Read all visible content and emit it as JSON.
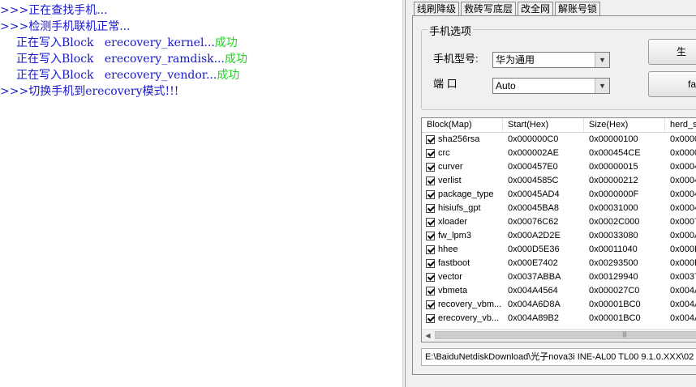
{
  "log": {
    "lines": [
      {
        "text": ">>>正在查找手机..."
      },
      {
        "text": ">>>检测手机联机正常..."
      },
      {
        "text": "正在写入Block   erecovery_kernel...",
        "status": "成功"
      },
      {
        "text": "正在写入Block   erecovery_ramdisk...",
        "status": "成功"
      },
      {
        "text": "正在写入Block   erecovery_vendor...",
        "status": "成功"
      },
      {
        "text": ">>>切换手机到erecovery模式!!!"
      }
    ]
  },
  "tabs": [
    "线刷降级",
    "救砖写底层",
    "改全网",
    "解账号锁"
  ],
  "phone_options": {
    "title": "手机选项",
    "model_label": "手机型号:",
    "model_value": "华为通用",
    "port_label": "端    口",
    "port_value": "Auto",
    "button1_label": "生",
    "button2_label": "fa"
  },
  "table": {
    "columns": [
      "Block(Map)",
      "Start(Hex)",
      "Size(Hex)",
      "herd_s"
    ],
    "rows": [
      {
        "checked": true,
        "block": "sha256rsa",
        "start": "0x000000C0",
        "size": "0x00000100",
        "herd": "0x0000"
      },
      {
        "checked": true,
        "block": "crc",
        "start": "0x000002AE",
        "size": "0x000454CE",
        "herd": "0x0000"
      },
      {
        "checked": true,
        "block": "curver",
        "start": "0x000457E0",
        "size": "0x00000015",
        "herd": "0x0004"
      },
      {
        "checked": true,
        "block": "verlist",
        "start": "0x0004585C",
        "size": "0x00000212",
        "herd": "0x0004"
      },
      {
        "checked": true,
        "block": "package_type",
        "start": "0x00045AD4",
        "size": "0x0000000F",
        "herd": "0x0004"
      },
      {
        "checked": true,
        "block": "hisiufs_gpt",
        "start": "0x00045BA8",
        "size": "0x00031000",
        "herd": "0x0004"
      },
      {
        "checked": true,
        "block": "xloader",
        "start": "0x00076C62",
        "size": "0x0002C000",
        "herd": "0x0007"
      },
      {
        "checked": true,
        "block": "fw_lpm3",
        "start": "0x000A2D2E",
        "size": "0x00033080",
        "herd": "0x000A"
      },
      {
        "checked": true,
        "block": "hhee",
        "start": "0x000D5E36",
        "size": "0x00011040",
        "herd": "0x000D"
      },
      {
        "checked": true,
        "block": "fastboot",
        "start": "0x000E7402",
        "size": "0x00293500",
        "herd": "0x000E"
      },
      {
        "checked": true,
        "block": "vector",
        "start": "0x0037ABBA",
        "size": "0x00129940",
        "herd": "0x0037"
      },
      {
        "checked": true,
        "block": "vbmeta",
        "start": "0x004A4564",
        "size": "0x000027C0",
        "herd": "0x004A"
      },
      {
        "checked": true,
        "block": "recovery_vbm...",
        "start": "0x004A6D8A",
        "size": "0x00001BC0",
        "herd": "0x004A"
      },
      {
        "checked": true,
        "block": "erecovery_vb...",
        "start": "0x004A89B2",
        "size": "0x00001BC0",
        "herd": "0x004A"
      }
    ]
  },
  "path": "E:\\BaiduNetdiskDownload\\光子nova3i INE-AL00 TL00 9.1.0.XXX\\02"
}
